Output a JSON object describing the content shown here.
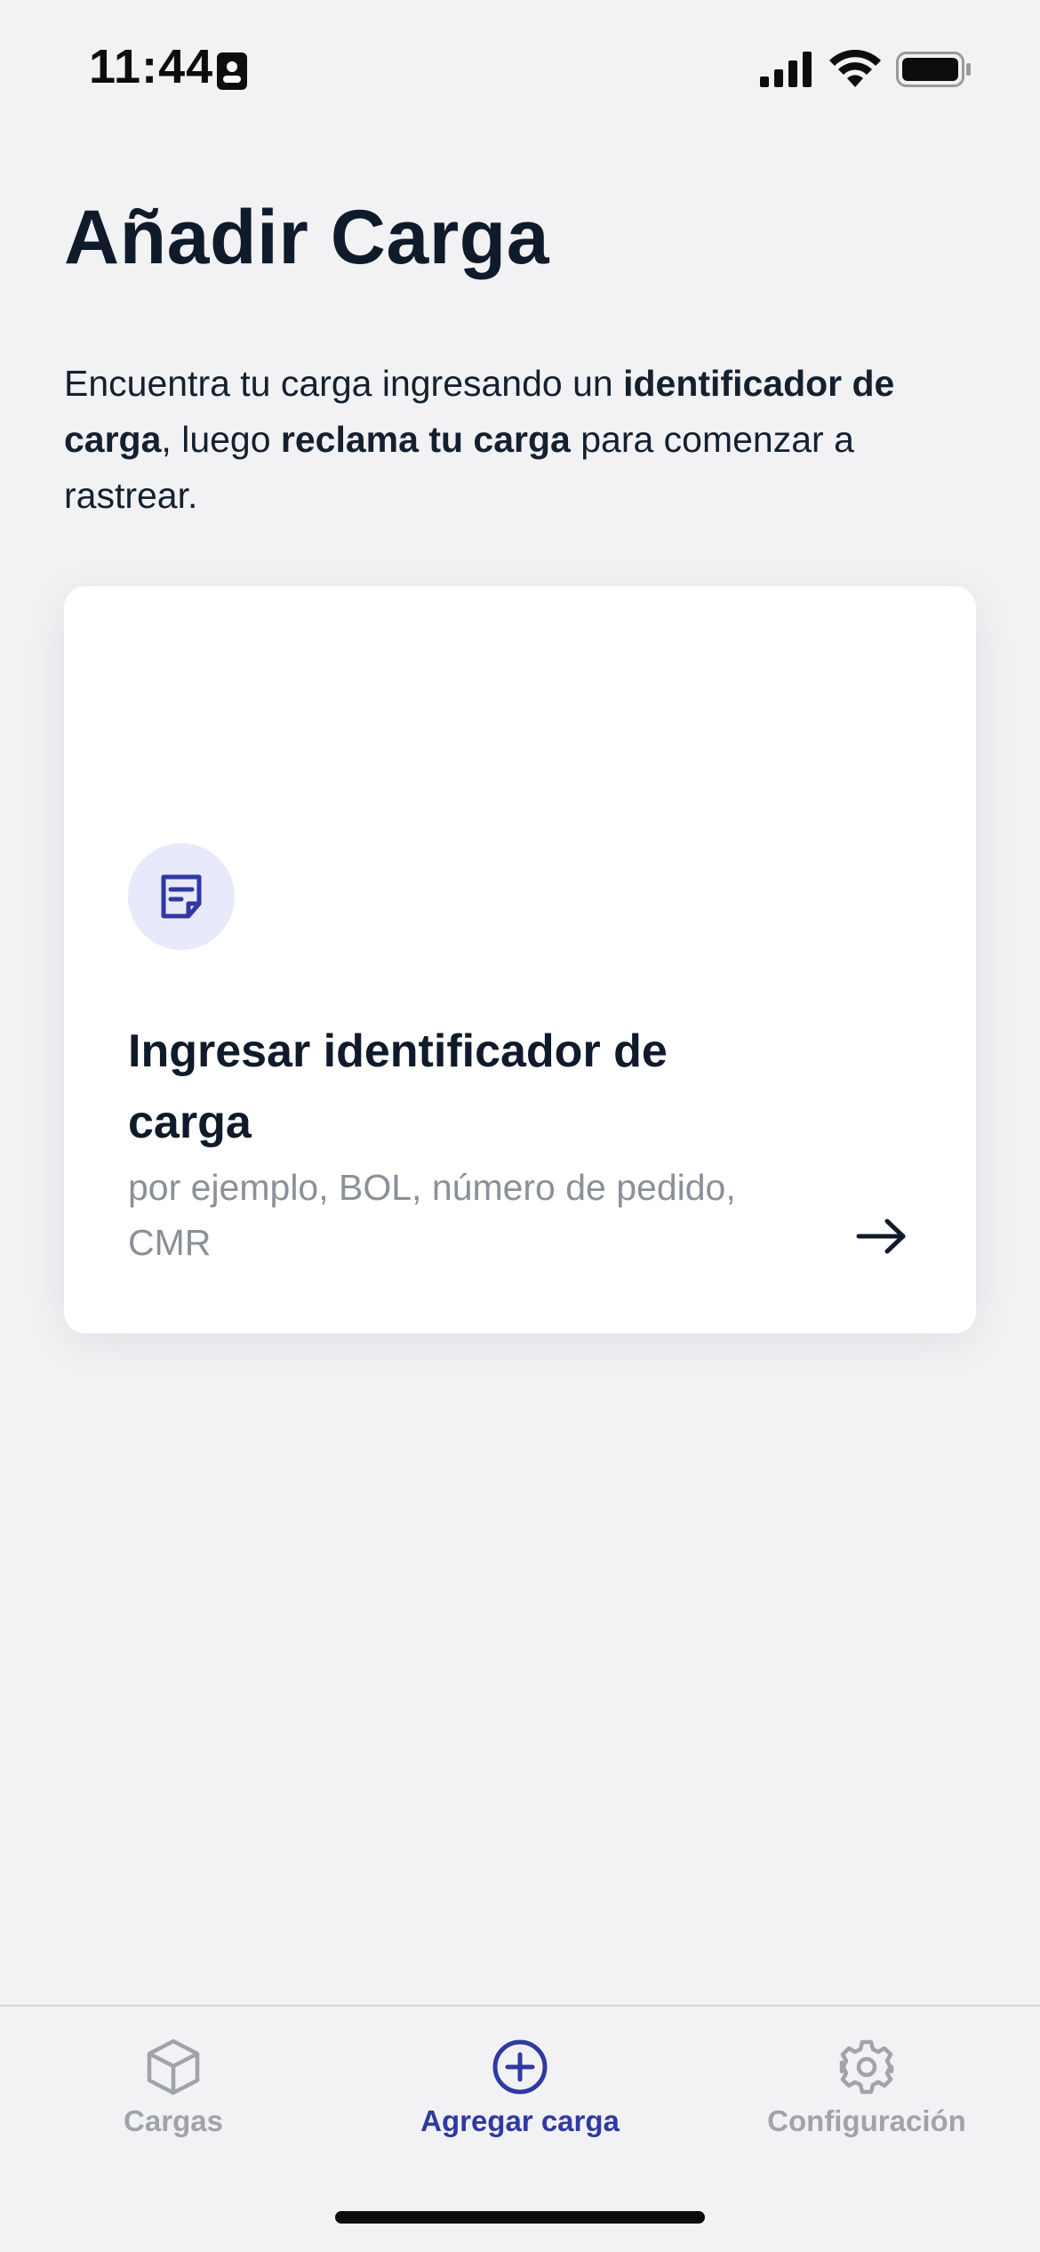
{
  "status_bar": {
    "time": "11:44",
    "icons": [
      "id-card-icon",
      "cellular-signal-icon",
      "wifi-icon",
      "battery-icon"
    ]
  },
  "header": {
    "title": "Añadir Carga",
    "intro": {
      "part1": "Encuentra tu carga ingresando un ",
      "bold1": "identificador de carga",
      "part2": ", luego ",
      "bold2": "reclama tu carga",
      "part3": " para comenzar a rastrear."
    }
  },
  "card": {
    "icon": "note-document-icon",
    "title": "Ingresar identificador de carga",
    "subtitle": "por ejemplo, BOL, número de pedido, CMR",
    "action_icon": "arrow-right-icon"
  },
  "tab_bar": {
    "tabs": [
      {
        "label": "Cargas",
        "icon": "cube-icon",
        "active": false
      },
      {
        "label": "Agregar carga",
        "icon": "plus-circle-icon",
        "active": true
      },
      {
        "label": "Configuración",
        "icon": "gear-icon",
        "active": false
      }
    ]
  },
  "colors": {
    "accent": "#3039a3",
    "background": "#f2f2f4",
    "card": "#ffffff",
    "text": "#0f1a2a",
    "muted": "#8a8f98",
    "icon_bg": "#e8e9fa"
  }
}
